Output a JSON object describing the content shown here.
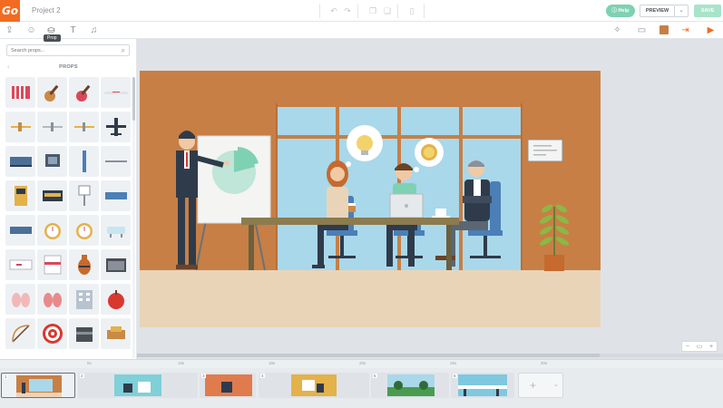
{
  "app": {
    "logo": "Go",
    "project_title": "Project 2"
  },
  "topbar": {
    "icons": [
      "undo-icon",
      "redo-icon",
      "copy-icon",
      "paste-icon",
      "delete-icon"
    ],
    "help_label": "Help",
    "preview_label": "PREVIEW",
    "save_label": "SAVE"
  },
  "toolbar": {
    "tools": [
      "upload-icon",
      "character-icon",
      "prop-icon",
      "text-icon",
      "music-icon"
    ],
    "tooltip": "Prop",
    "right_icons": [
      "effects-icon",
      "layout-icon",
      "color-swatch",
      "exit-icon",
      "camera-icon"
    ],
    "swatch_color": "#c77f45"
  },
  "props_panel": {
    "search_placeholder": "Search props...",
    "title": "PROPS",
    "items": [
      "accordion",
      "acoustic guitar",
      "electric guitar",
      "airliner",
      "biplane",
      "jet",
      "propeller plane",
      "airplane",
      "airport seats",
      "luggage cart",
      "pole",
      "bench",
      "atm",
      "cashier",
      "sign",
      "seats",
      "bus seats",
      "alarm clock",
      "alarm clock",
      "bathtub",
      "ambulance",
      "ambulance",
      "amphora",
      "amplifier",
      "lungs",
      "lungs",
      "apartment",
      "apple",
      "bow",
      "target",
      "box",
      "sofa"
    ]
  },
  "scene": {
    "wall_color": "#c77f45",
    "floor_color": "#ead4b8",
    "window_color": "#a9d8ea"
  },
  "timeline": {
    "ruler_marks": [
      "5s",
      "10s",
      "15s",
      "20s",
      "25s",
      "30s"
    ],
    "scenes": [
      {
        "num": "1",
        "color": "#c77f45"
      },
      {
        "num": "2",
        "color": "#7fd0d8"
      },
      {
        "num": "3",
        "color": "#e07b4e"
      },
      {
        "num": "4",
        "color": "#e3b24a"
      },
      {
        "num": "5",
        "color": "#4a9b4f"
      },
      {
        "num": "6",
        "color": "#7fc8e0"
      }
    ],
    "add_label": "+"
  },
  "zoom": {
    "minus": "−",
    "fit": "▭",
    "plus": "+"
  }
}
